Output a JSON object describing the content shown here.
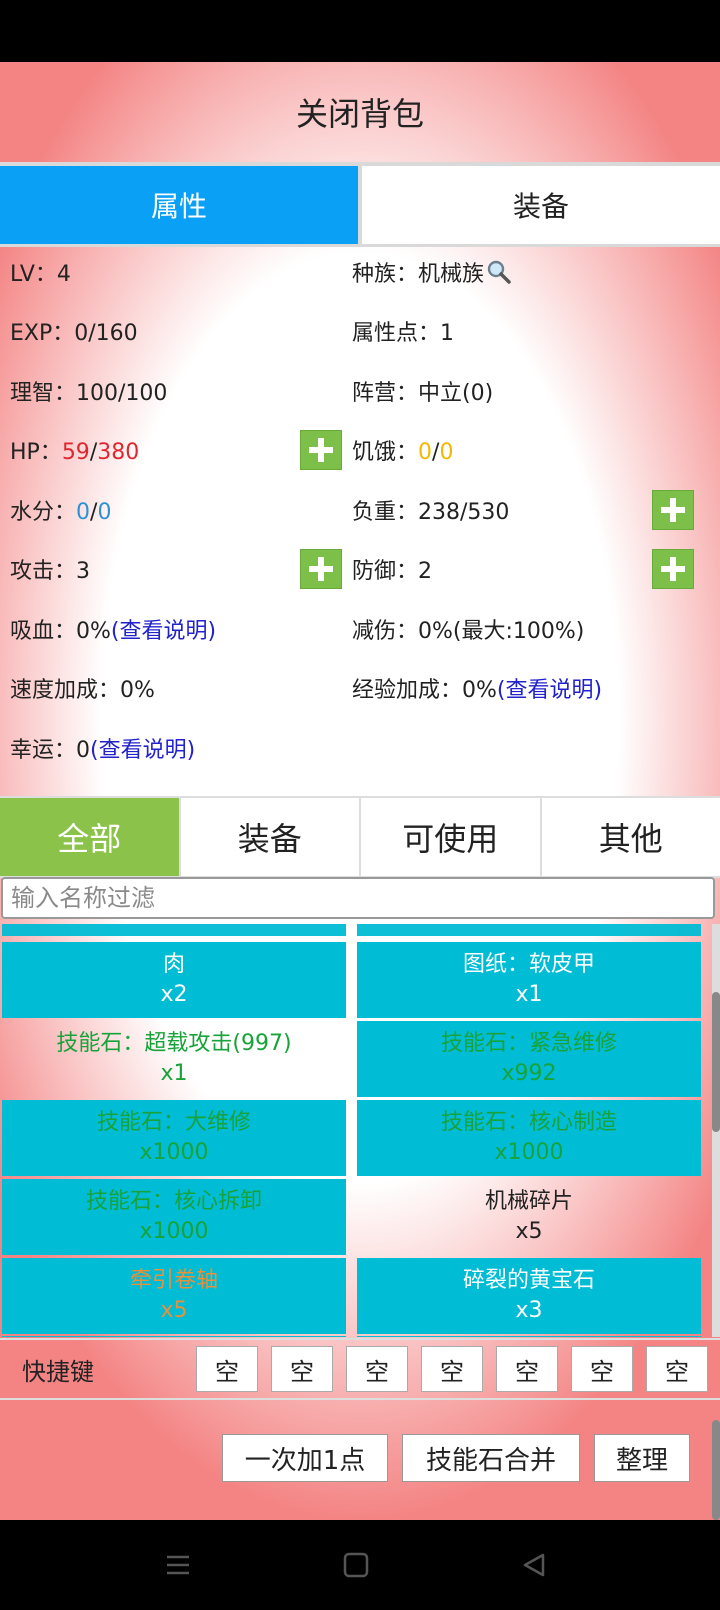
{
  "header": {
    "title": "关闭背包"
  },
  "tabs": [
    {
      "label": "属性"
    },
    {
      "label": "装备"
    }
  ],
  "stats": {
    "lv": {
      "label": "LV：",
      "value": "4"
    },
    "race": {
      "label": "种族：",
      "value": "机械族",
      "icon": "magnifier-icon"
    },
    "exp": {
      "label": "EXP：",
      "value": "0/160"
    },
    "attr_points": {
      "label": "属性点：",
      "value": "1"
    },
    "sanity": {
      "label": "理智：",
      "value": "100/100"
    },
    "camp": {
      "label": "阵营：",
      "value": "中立(0)"
    },
    "hp": {
      "label": "HP：",
      "current": "59",
      "sep": "/",
      "max": "380"
    },
    "hunger": {
      "label": "饥饿：",
      "current": "0",
      "sep": "/",
      "max": "0"
    },
    "water": {
      "label": "水分：",
      "current": "0",
      "sep": "/",
      "max": "0"
    },
    "load": {
      "label": "负重：",
      "value": "238/530"
    },
    "attack": {
      "label": "攻击：",
      "value": "3"
    },
    "defense": {
      "label": "防御：",
      "value": "2"
    },
    "lifesteal": {
      "label": "吸血：",
      "value": "0%",
      "link": "(查看说明)"
    },
    "damage_reduction": {
      "label": "减伤：",
      "value": "0%(最大:100%)"
    },
    "speed_bonus": {
      "label": "速度加成：",
      "value": "0%"
    },
    "exp_bonus": {
      "label": "经验加成：",
      "value": "0%",
      "link": "(查看说明)"
    },
    "luck": {
      "label": "幸运：",
      "value": "0",
      "link": "(查看说明)"
    },
    "plus_label": "+"
  },
  "categories": [
    {
      "label": "全部"
    },
    {
      "label": "装备"
    },
    {
      "label": "可使用"
    },
    {
      "label": "其他"
    }
  ],
  "filter": {
    "placeholder": "输入名称过滤",
    "value": ""
  },
  "items": [
    {
      "name": "肉",
      "count": "x2",
      "color": "#ffffff",
      "bg": "cyan"
    },
    {
      "name": "图纸：软皮甲",
      "count": "x1",
      "color": "#ffffff",
      "bg": "cyan"
    },
    {
      "name": "技能石：超载攻击(997)",
      "count": "x1",
      "color": "#18a33a",
      "bg": "plain"
    },
    {
      "name": "技能石：紧急维修",
      "count": "x992",
      "color": "#18a33a",
      "bg": "cyan"
    },
    {
      "name": "技能石：大维修",
      "count": "x1000",
      "color": "#18a33a",
      "bg": "cyan"
    },
    {
      "name": "技能石：核心制造",
      "count": "x1000",
      "color": "#18a33a",
      "bg": "cyan"
    },
    {
      "name": "技能石：核心拆卸",
      "count": "x1000",
      "color": "#18a33a",
      "bg": "cyan"
    },
    {
      "name": "机械碎片",
      "count": "x5",
      "color": "#222222",
      "bg": "plain"
    },
    {
      "name": "牵引卷轴",
      "count": "x5",
      "color": "#e8903a",
      "bg": "cyan"
    },
    {
      "name": "碎裂的黄宝石",
      "count": "x3",
      "color": "#ffffff",
      "bg": "cyan"
    }
  ],
  "quickbar": {
    "label": "快捷键",
    "slots": [
      "空",
      "空",
      "空",
      "空",
      "空",
      "空",
      "空"
    ]
  },
  "actions": [
    {
      "label": "一次加1点"
    },
    {
      "label": "技能石合并"
    },
    {
      "label": "整理"
    }
  ],
  "colors": {
    "tab_active": "#0aa0f5",
    "category_active": "#8bc34a",
    "item_cyan": "#00bcd4",
    "plus_button": "#7cc04a",
    "hp_red": "#e0262f",
    "water_blue": "#2a93d5",
    "hunger_gold": "#f2b900",
    "link_blue": "#2222cc"
  }
}
